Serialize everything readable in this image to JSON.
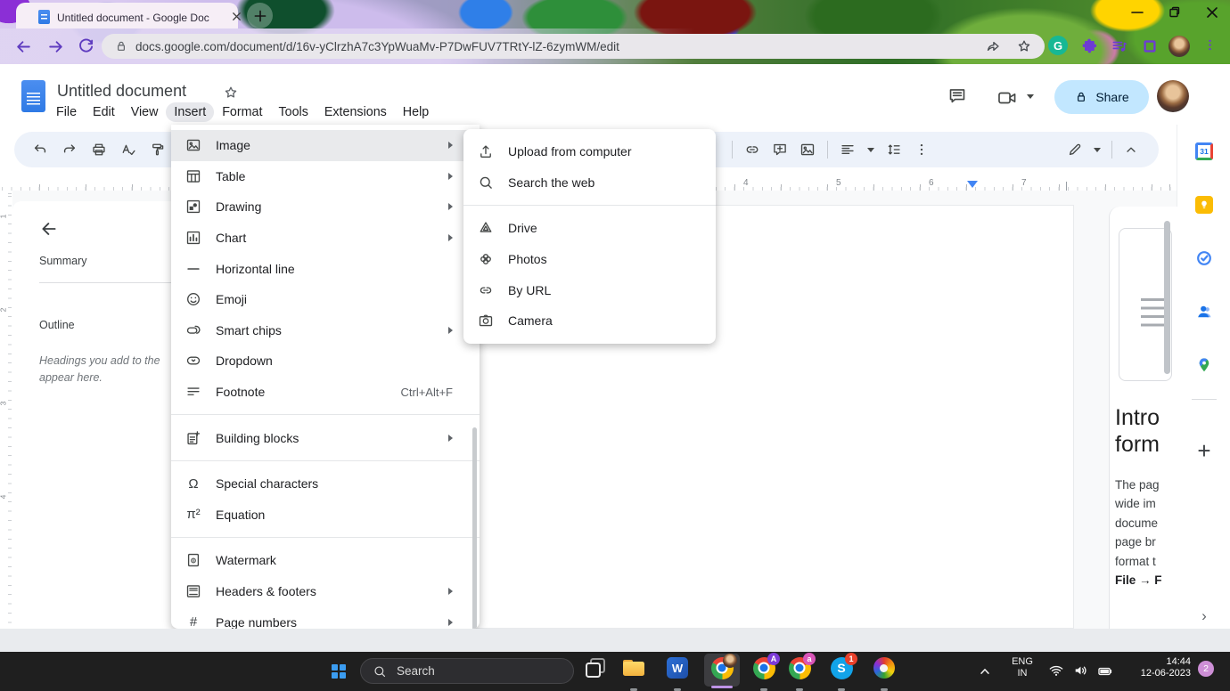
{
  "browser": {
    "tab": {
      "title": "Untitled document - Google Doc"
    },
    "window_controls": [
      "minimize",
      "restore",
      "close"
    ],
    "nav_icons": [
      "back",
      "forward",
      "reload"
    ],
    "url": "docs.google.com/document/d/16v-yClrzhA7c3YpWuaMv-P7DwFUV7TRtY-lZ-6zymWM/edit",
    "url_actions": [
      "share",
      "star"
    ],
    "extension_icons": [
      "grammarly",
      "puzzle",
      "playlist",
      "square-ext",
      "browser-menu"
    ],
    "grammarly_letter": "G"
  },
  "docs": {
    "title": "Untitled document",
    "menu_items": [
      "File",
      "Edit",
      "View",
      "Insert",
      "Format",
      "Tools",
      "Extensions",
      "Help"
    ],
    "active_menu": "Insert",
    "share_label": "Share"
  },
  "toolbar": {
    "left_icons": [
      "undo",
      "redo",
      "print",
      "spell-check",
      "paint-format"
    ],
    "mid_icons": [
      "menu-overflow",
      "|",
      "insert-link",
      "add-comment",
      "insert-image",
      "|",
      {
        "icon": "align",
        "caret": true
      },
      "line-spacing",
      "more-vert"
    ],
    "right_icons": [
      {
        "icon": "editing-mode",
        "caret": true
      },
      "|",
      "collapse-toolbar"
    ]
  },
  "insert_menu": {
    "items": [
      {
        "icon": "image",
        "label": "Image",
        "submenu": true,
        "highlighted": true
      },
      {
        "icon": "table",
        "label": "Table",
        "submenu": true
      },
      {
        "icon": "drawing",
        "label": "Drawing",
        "submenu": true
      },
      {
        "icon": "chart",
        "label": "Chart",
        "submenu": true
      },
      {
        "icon": "hline",
        "label": "Horizontal line"
      },
      {
        "icon": "emoji",
        "label": "Emoji"
      },
      {
        "icon": "smart-chips",
        "label": "Smart chips",
        "submenu": true
      },
      {
        "icon": "dropdown",
        "label": "Dropdown"
      },
      {
        "icon": "footnote",
        "label": "Footnote",
        "shortcut": "Ctrl+Alt+F"
      },
      {
        "type": "separator"
      },
      {
        "icon": "building-blocks",
        "label": "Building blocks",
        "submenu": true
      },
      {
        "type": "separator"
      },
      {
        "icon": "omega",
        "label": "Special characters"
      },
      {
        "icon": "pi",
        "label": "Equation"
      },
      {
        "type": "separator"
      },
      {
        "icon": "watermark",
        "label": "Watermark"
      },
      {
        "icon": "headers-footers",
        "label": "Headers & footers",
        "submenu": true
      },
      {
        "icon": "page-numbers",
        "label": "Page numbers",
        "submenu": true
      }
    ]
  },
  "image_submenu": {
    "items": [
      {
        "icon": "upload",
        "label": "Upload from computer"
      },
      {
        "icon": "search",
        "label": "Search the web"
      },
      {
        "type": "separator"
      },
      {
        "icon": "drive",
        "label": "Drive"
      },
      {
        "icon": "photos",
        "label": "Photos"
      },
      {
        "icon": "by-url",
        "label": "By URL"
      },
      {
        "icon": "camera",
        "label": "Camera"
      }
    ]
  },
  "outline_panel": {
    "summary_label": "Summary",
    "outline_label": "Outline",
    "hint_line1": "Headings you add to the",
    "hint_line2": "appear here."
  },
  "ruler": {
    "numbers": [
      "4",
      "5",
      "6",
      "7"
    ]
  },
  "vertical_ruler": {
    "numbers": [
      "1",
      "2",
      "3",
      "4"
    ]
  },
  "promo_panel": {
    "heading_lines": [
      "Intro",
      "form"
    ],
    "body_lines": [
      "The pag",
      "wide im",
      "docume",
      "page br",
      "format t"
    ],
    "bold_line": "File → F"
  },
  "side_panel": {
    "icons": [
      "calendar",
      "keep",
      "tasks",
      "contacts",
      "maps"
    ],
    "calendar_label": "31",
    "plus_icon": "+",
    "collapse_icon": "›"
  },
  "taskbar": {
    "search_placeholder": "Search",
    "apps": [
      {
        "icon": "task-view"
      },
      {
        "icon": "file-explorer"
      },
      {
        "icon": "word",
        "letter": "W"
      },
      {
        "icon": "chrome",
        "active": true,
        "has_avatar": true
      },
      {
        "icon": "chrome",
        "badge": "A",
        "badge_color": "#7d3bd8"
      },
      {
        "icon": "chrome",
        "badge": "a",
        "badge_color": "#d955b8"
      },
      {
        "icon": "skype",
        "letter": "S",
        "badge": "1",
        "badge_color": "#e8402a"
      },
      {
        "icon": "paint"
      }
    ],
    "tray": {
      "language_top": "ENG",
      "language_bottom": "IN",
      "time": "14:44",
      "date": "12-06-2023",
      "notification_badge": "2"
    }
  },
  "colors": {
    "share_button_bg": "#c2e7ff",
    "active_tab_bg": "#f6eef6",
    "taskbar_bg": "#1f1f1f",
    "accent_blue": "#4285f4"
  }
}
